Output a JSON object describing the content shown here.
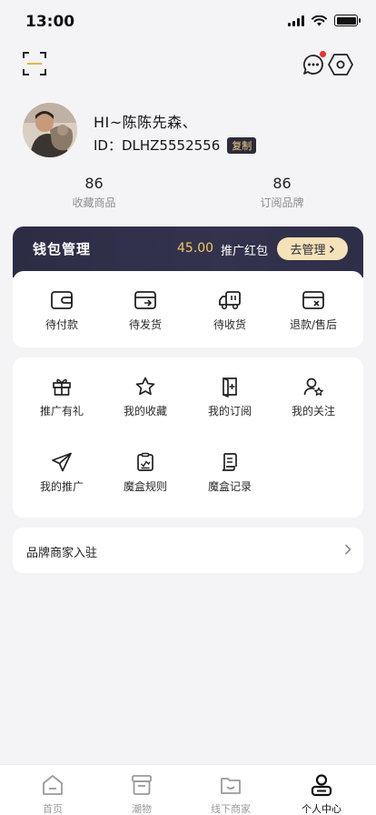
{
  "status_bar": {
    "time": "13:00"
  },
  "profile": {
    "greeting": "HI~陈陈先森、",
    "uid": "ID：DLHZ5552556",
    "copy_label": "复制"
  },
  "stats": [
    {
      "value": "86",
      "label": "收藏商品"
    },
    {
      "value": "86",
      "label": "订阅品牌"
    }
  ],
  "wallet": {
    "title": "钱包管理",
    "amount": "45.00",
    "amount_label": "推广红包",
    "manage_label": "去管理",
    "accent_color": "#f3c85c"
  },
  "orders": [
    {
      "label": "待付款",
      "icon": "wallet-icon"
    },
    {
      "label": "待发货",
      "icon": "shipping-card-icon"
    },
    {
      "label": "待收货",
      "icon": "truck-icon"
    },
    {
      "label": "退款/售后",
      "icon": "refund-card-icon"
    }
  ],
  "services": [
    {
      "label": "推广有礼",
      "icon": "gift-icon"
    },
    {
      "label": "我的收藏",
      "icon": "star-icon"
    },
    {
      "label": "我的订阅",
      "icon": "book-add-icon"
    },
    {
      "label": "我的关注",
      "icon": "user-star-icon"
    },
    {
      "label": "我的推广",
      "icon": "paper-plane-icon"
    },
    {
      "label": "魔盒规则",
      "icon": "clipboard-icon"
    },
    {
      "label": "魔盒记录",
      "icon": "scroll-icon"
    }
  ],
  "merchant": {
    "label": "品牌商家入驻"
  },
  "tabbar": [
    {
      "label": "首页",
      "icon": "home-icon",
      "active": false
    },
    {
      "label": "潮物",
      "icon": "box-icon",
      "active": false
    },
    {
      "label": "线下商家",
      "icon": "store-icon",
      "active": false
    },
    {
      "label": "个人中心",
      "icon": "profile-icon",
      "active": true
    }
  ]
}
